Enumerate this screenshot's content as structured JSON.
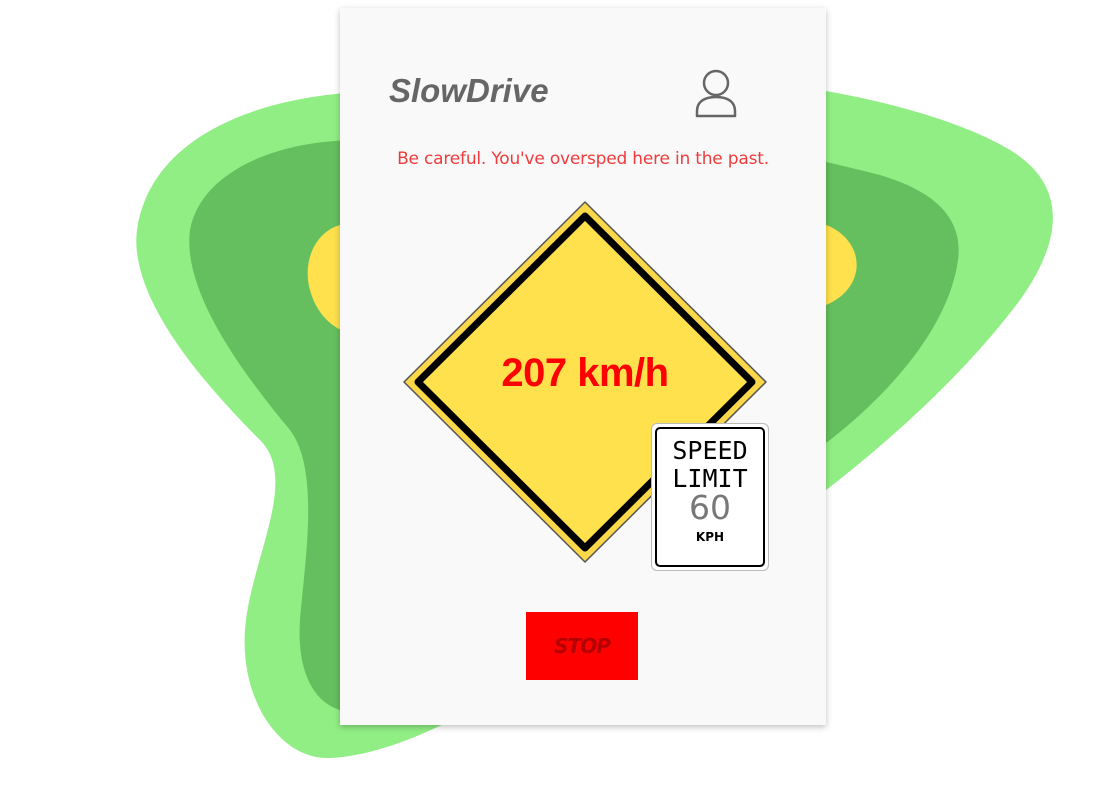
{
  "app": {
    "title": "SlowDrive",
    "warning": "Be careful. You've oversped here in the past."
  },
  "speed": {
    "current": "207 km/h"
  },
  "speed_limit_sign": {
    "line1": "SPEED",
    "line2": "LIMIT",
    "value": "60",
    "unit": "KPH"
  },
  "controls": {
    "stop_label": "STOP"
  },
  "icons": {
    "profile": "user-icon"
  },
  "colors": {
    "warning_text": "#ef3b3b",
    "speed_text": "#ff0000",
    "sign_yellow": "#ffe14d",
    "stop_button": "#ff0000",
    "blob_light": "#90ee84",
    "blob_mid": "#66bf5e",
    "blob_core": "#ffe14d"
  }
}
